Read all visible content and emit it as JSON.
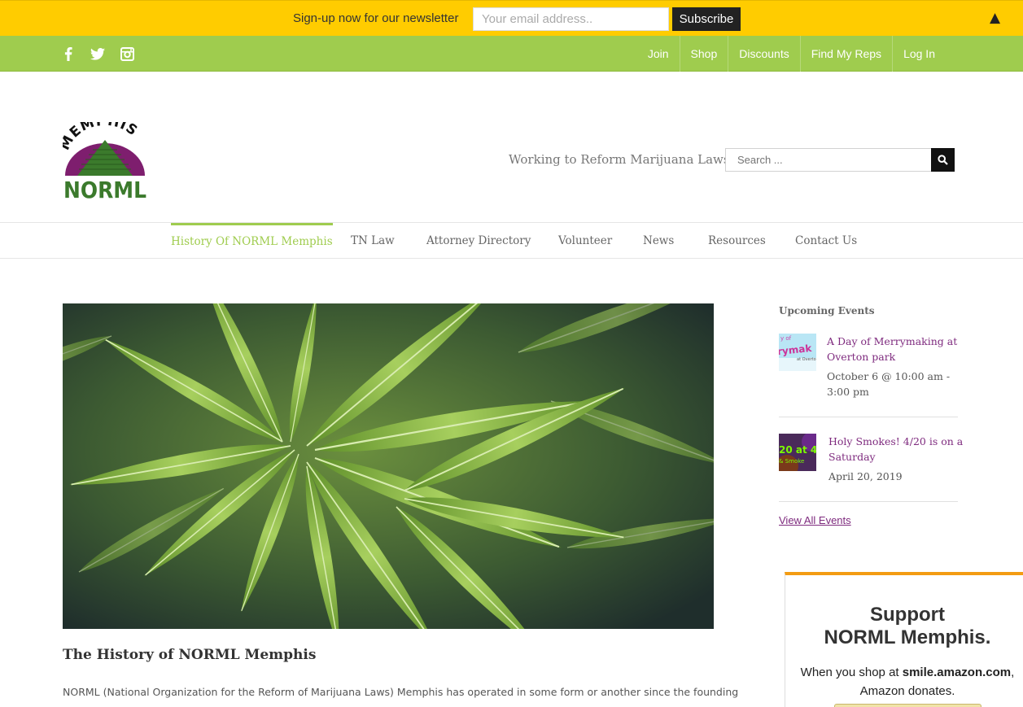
{
  "newsletter": {
    "text": "Sign-up now for our newsletter",
    "email_placeholder": "Your email address..",
    "subscribe_label": "Subscribe",
    "collapse_glyph": "▲"
  },
  "social": [
    {
      "name": "facebook-icon",
      "glyph": "f"
    },
    {
      "name": "twitter-icon",
      "glyph": "twitter"
    },
    {
      "name": "instagram-icon",
      "glyph": "instagram"
    }
  ],
  "topnav": [
    "Join",
    "Shop",
    "Discounts",
    "Find My Reps",
    "Log In"
  ],
  "header": {
    "logo_top_text": "MEMPHIS",
    "logo_bottom_text": "NORML",
    "tagline": "Working to Reform Marijuana Laws",
    "search_placeholder": "Search ..."
  },
  "mainnav": [
    "History Of NORML Memphis",
    "TN Law",
    "Attorney Directory",
    "Volunteer",
    "News",
    "Resources",
    "Contact Us"
  ],
  "content": {
    "page_title": "The History of NORML Memphis",
    "intro": "NORML (National Organization for the Reform of Marijuana Laws) Memphis has operated in some form or another since the founding"
  },
  "sidebar": {
    "title": "Upcoming Events",
    "events": [
      {
        "title_line1": "A Day of Merrymaking at",
        "title_line2": "Overton park",
        "date_line1": "October 6 @ 10:00 am -",
        "date_line2": "3:00 pm"
      },
      {
        "title_line1": "Holy Smokes! 4/20 is on a",
        "title_line2": "Saturday",
        "date_line1": "April 20, 2019"
      }
    ],
    "view_all": "View All Events"
  },
  "support": {
    "heading_line1": "Support",
    "heading_line2": "NORML Memphis.",
    "line1_prefix": "When you shop at ",
    "line1_bold": "smile.amazon.com",
    "line1_suffix": ",",
    "line2": "Amazon donates."
  },
  "colors": {
    "newsletter_bg": "#ffcc00",
    "topbar_bg": "#9fcc4e",
    "active_nav": "#9fcc4e",
    "event_link": "#7e2a7e",
    "support_accent": "#f39c12"
  }
}
